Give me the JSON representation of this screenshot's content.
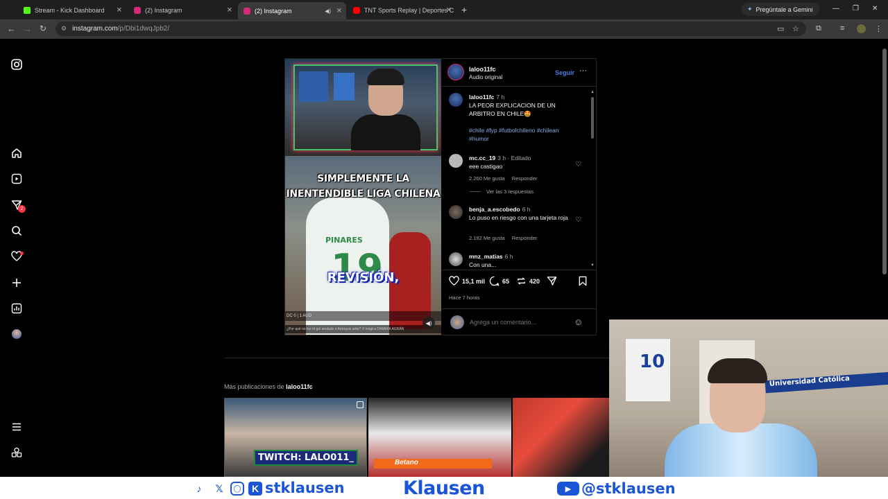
{
  "browser": {
    "tabs": [
      {
        "title": "Stream - Kick Dashboard",
        "color": "#53fc18"
      },
      {
        "title": "(2) Instagram",
        "color": "#d62976"
      },
      {
        "title": "(2) Instagram",
        "color": "#d62976"
      },
      {
        "title": "TNT Sports Replay | Deportes C",
        "color": "#ff0000"
      }
    ],
    "gemini_label": "Pregúntale a Gemini",
    "url_host": "instagram.com",
    "url_path": "/p/Dbi1dwqJpb2/"
  },
  "post": {
    "username": "laloo11fc",
    "audio": "Audio original",
    "follow_label": "Seguir",
    "video": {
      "caption_top": "SIMPLEMENTE LA INENTENDIBLE LIGA CHILENA",
      "caption_bottom": "REVISIÓN,",
      "jersey_name": "PINARES",
      "jersey_number": "19",
      "score_text": "DC 0 | 1 AUD",
      "ticker_text": "¿Por qué no fue el gol anulado a Aránguiz ante?  X  mágica  DAMIÁN AGRÁN"
    },
    "caption": {
      "user": "laloo11fc",
      "time": "7 h",
      "text": "LA PEOR EXPLICACION DE UN ARBITRO EN CHILE🤩",
      "tags": "#chile #fyp #futbolchileno #chilean #humor"
    },
    "comments": [
      {
        "user": "mc.cc_19",
        "time": "3 h · Editado",
        "text": "eee castigao",
        "likes": "2.260 Me gusta",
        "reply": "Responder"
      },
      {
        "user": "benja_a.escobedo",
        "time": "6 h",
        "text": "Lo puso en riesgo con una tarjeta roja",
        "likes": "2.192 Me gusta",
        "reply": "Responder"
      },
      {
        "user": "mnz_matias",
        "time": "6 h",
        "text": "Con una...",
        "likes": "",
        "reply": ""
      }
    ],
    "view_replies": "Ver las 3 respuestas",
    "stats": {
      "likes": "15,1 mil",
      "comments": "65",
      "reposts": "420"
    },
    "posted_ago": "Hace 7 horas",
    "comment_placeholder": "Agrega un comentario..."
  },
  "more_posts": {
    "prefix": "Más publicaciones de",
    "user": "laloo11fc",
    "thumb1_label": "TWITCH: LALO011_",
    "thumb2_label": "Betano"
  },
  "webcam": {
    "jersey_number": "10",
    "scarf_text": "Universidad Católica"
  },
  "footer": {
    "left_handle": "stklausen",
    "brand": "Klausen",
    "right_handle": "@stklausen"
  },
  "colors": {
    "accent": "#4c7ce6",
    "brand_blue": "#1a55d6",
    "notification": "#ff3040"
  }
}
